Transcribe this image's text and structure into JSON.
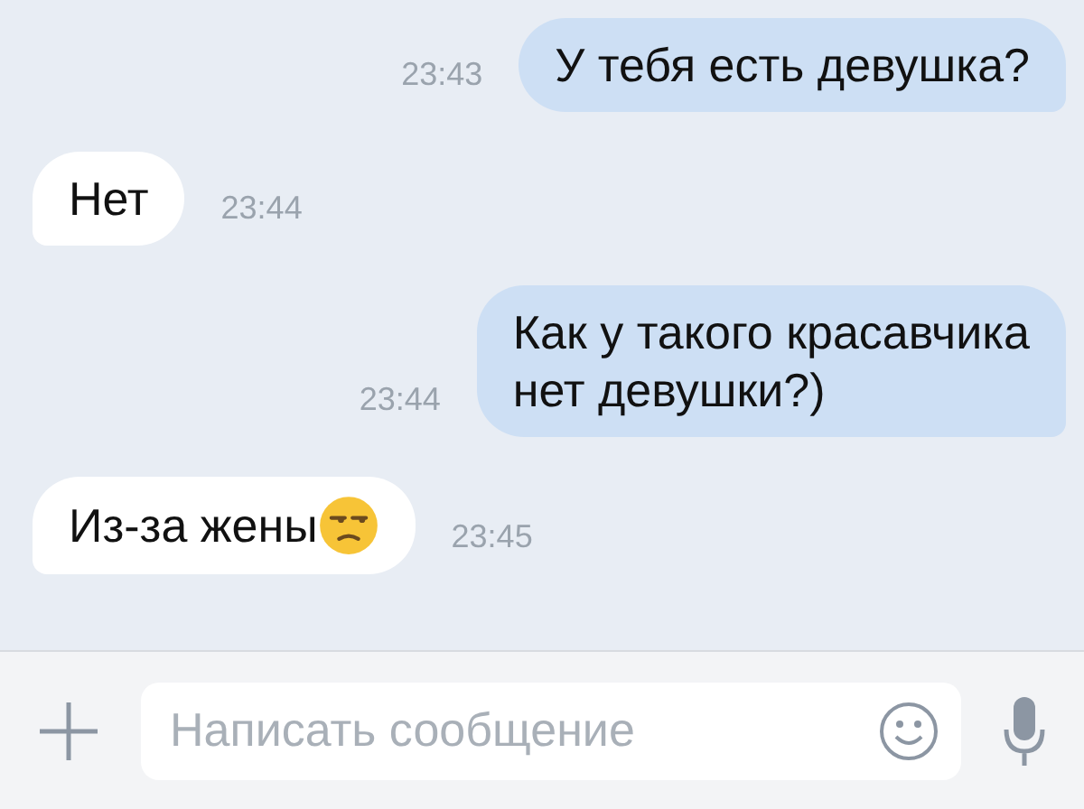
{
  "messages": [
    {
      "kind": "outgoing",
      "lines": [
        "У тебя есть девушка?"
      ],
      "time": "23:43"
    },
    {
      "kind": "incoming",
      "lines": [
        "Нет"
      ],
      "time": "23:44"
    },
    {
      "kind": "outgoing",
      "lines": [
        "Как у такого красавчика",
        "нет девушки?)"
      ],
      "time": "23:44"
    },
    {
      "kind": "incoming",
      "lines": [
        "Из-за жены"
      ],
      "icons": [
        {
          "kind": "unamused"
        }
      ],
      "time": "23:45"
    }
  ],
  "composer": {
    "placeholder": "Написать сообщение"
  }
}
